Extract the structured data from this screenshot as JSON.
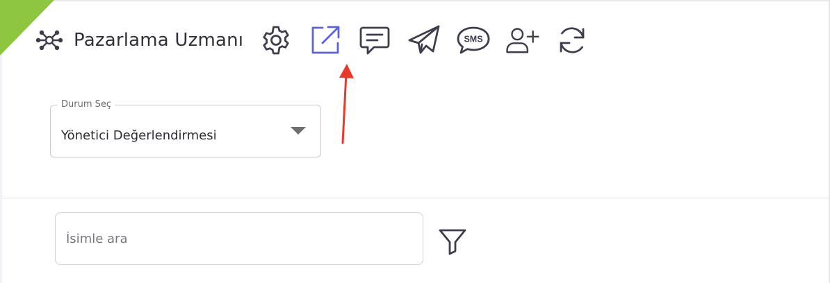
{
  "header": {
    "title": "Pazarlama Uzmanı",
    "title_icon": "network-icon",
    "toolbar": [
      {
        "icon": "gear-icon"
      },
      {
        "icon": "external-link-icon",
        "active": true
      },
      {
        "icon": "message-icon"
      },
      {
        "icon": "send-icon"
      },
      {
        "icon": "sms-icon",
        "text": "SMS"
      },
      {
        "icon": "add-user-icon"
      },
      {
        "icon": "refresh-icon"
      }
    ]
  },
  "status_select": {
    "label": "Durum Seç",
    "value": "Yönetici Değerlendirmesi"
  },
  "search": {
    "placeholder": "İsimle ara",
    "value": ""
  },
  "filter": {
    "icon": "filter-icon"
  },
  "colors": {
    "accent": "#5b63d6",
    "icon": "#3d3d4c",
    "ribbon": "#8dc63f",
    "annotation_arrow": "#e8392b"
  }
}
